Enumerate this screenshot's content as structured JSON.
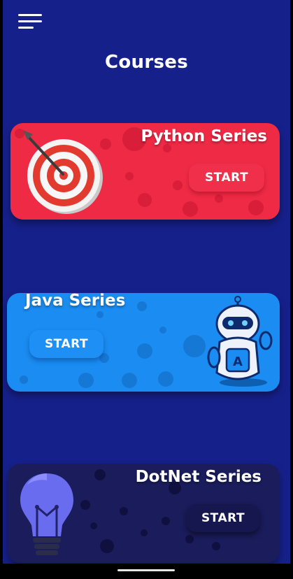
{
  "header": {
    "title": "Courses"
  },
  "cards": [
    {
      "title": "Python Series",
      "button": "START",
      "icon": "target-icon",
      "color": "#ef2a45"
    },
    {
      "title": "Java Series",
      "button": "START",
      "icon": "robot-icon",
      "color": "#1a8cf2"
    },
    {
      "title": "DotNet Series",
      "button": "START",
      "icon": "lightbulb-icon",
      "color": "#1a1c5c"
    }
  ],
  "robot_badge": "A",
  "colors": {
    "background": "#16208a",
    "python": "#ef2a45",
    "java": "#1a8cf2",
    "dotnet": "#1a1c5c"
  }
}
